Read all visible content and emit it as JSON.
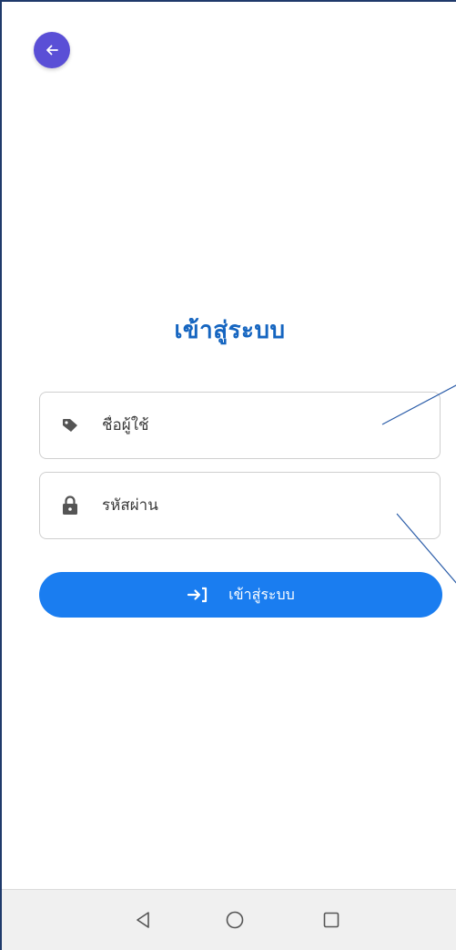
{
  "header": {
    "back_icon": "arrow-left-icon",
    "back_color": "#5a4fd6"
  },
  "login": {
    "title": "เข้าสู่ระบบ",
    "title_color": "#1565c0",
    "username": {
      "placeholder": "ชื่อผู้ใช้",
      "value": "",
      "icon": "tag-icon"
    },
    "password": {
      "placeholder": "รหัสผ่าน",
      "value": "",
      "icon": "lock-icon"
    },
    "submit_label": "เข้าสู่ระบบ",
    "submit_icon": "login-arrow-icon",
    "submit_color": "#1a7df0"
  },
  "navbar": {
    "back_icon": "triangle-back-icon",
    "home_icon": "circle-home-icon",
    "recent_icon": "square-recents-icon"
  }
}
